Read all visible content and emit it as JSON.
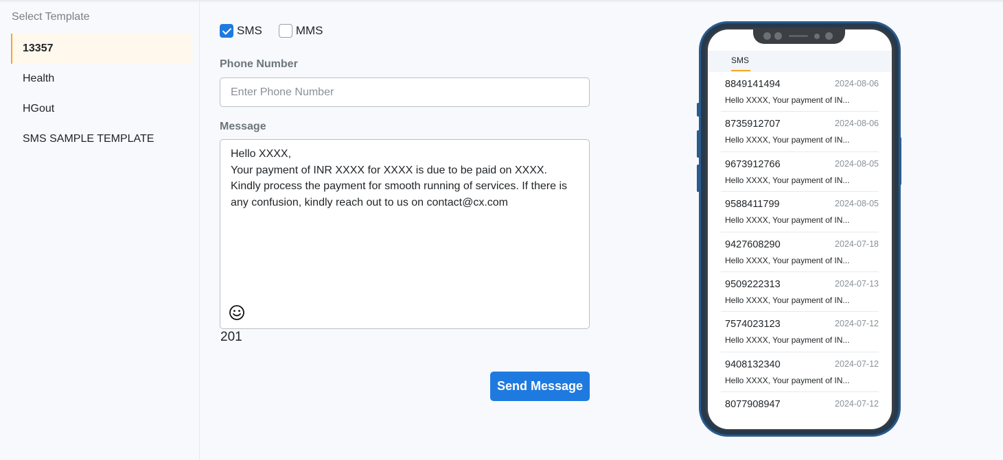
{
  "sidebar": {
    "heading": "Select Template",
    "items": [
      {
        "label": "13357"
      },
      {
        "label": "Health"
      },
      {
        "label": "HGout"
      },
      {
        "label": "SMS SAMPLE TEMPLATE"
      }
    ]
  },
  "form": {
    "channels": [
      {
        "label": "SMS",
        "checked": true
      },
      {
        "label": "MMS",
        "checked": false
      }
    ],
    "phone_label": "Phone Number",
    "phone_placeholder": "Enter Phone Number",
    "phone_value": "",
    "message_label": "Message",
    "message_text": "Hello XXXX,\nYour payment of INR XXXX for XXXX is due to be paid on XXXX.\nKindly process the payment for smooth running of services. If there is any confusion, kindly reach out to us on contact@cx.com",
    "char_count": "201",
    "send_label": "Send Message"
  },
  "preview": {
    "tab_label": "SMS",
    "messages": [
      {
        "number": "8849141494",
        "date": "2024-08-06",
        "preview": "Hello XXXX, Your payment of IN..."
      },
      {
        "number": "8735912707",
        "date": "2024-08-06",
        "preview": "Hello XXXX, Your payment of IN..."
      },
      {
        "number": "9673912766",
        "date": "2024-08-05",
        "preview": "Hello XXXX, Your payment of IN..."
      },
      {
        "number": "9588411799",
        "date": "2024-08-05",
        "preview": "Hello XXXX, Your payment of IN..."
      },
      {
        "number": "9427608290",
        "date": "2024-07-18",
        "preview": "Hello XXXX, Your payment of IN..."
      },
      {
        "number": "9509222313",
        "date": "2024-07-13",
        "preview": "Hello XXXX, Your payment of IN..."
      },
      {
        "number": "7574023123",
        "date": "2024-07-12",
        "preview": "Hello XXXX, Your payment of IN..."
      },
      {
        "number": "9408132340",
        "date": "2024-07-12",
        "preview": "Hello XXXX, Your payment of IN..."
      },
      {
        "number": "8077908947",
        "date": "2024-07-12",
        "preview": ""
      }
    ]
  },
  "colors": {
    "accent": "#1f7ae0",
    "active_indicator": "#f5a623",
    "phone_frame": "#2a5b8f"
  },
  "icons": {
    "emoji": "smiley-face-icon",
    "checkbox_checked": "checkmark-icon"
  }
}
